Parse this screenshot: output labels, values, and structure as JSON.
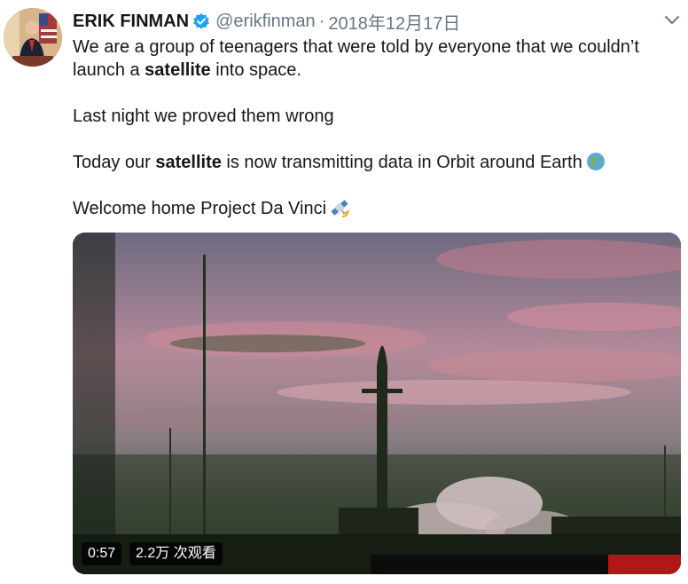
{
  "author": {
    "name": "ERIK FINMAN",
    "handle": "@erikfinman",
    "separator": "·",
    "date": "2018年12月17日"
  },
  "icons": {
    "verified": "verified-badge-icon",
    "menu": "chevron-down-icon",
    "globe": "globe-emoji",
    "satellite": "satellite-emoji"
  },
  "tweet": {
    "line1_a": "We are a group of teenagers that were told by everyone that we couldn’t launch a ",
    "line1_b": "satellite",
    "line1_c": " into space.",
    "line2": "Last night we proved them wrong",
    "line3_a": "Today our ",
    "line3_b": "satellite",
    "line3_c": " is now transmitting data in Orbit around Earth",
    "line4": "Welcome home Project Da Vinci"
  },
  "video": {
    "duration": "0:57",
    "views": "2.2万 次观看"
  },
  "colors": {
    "text": "#14171a",
    "secondary": "#657786",
    "verified": "#1da1f2"
  }
}
